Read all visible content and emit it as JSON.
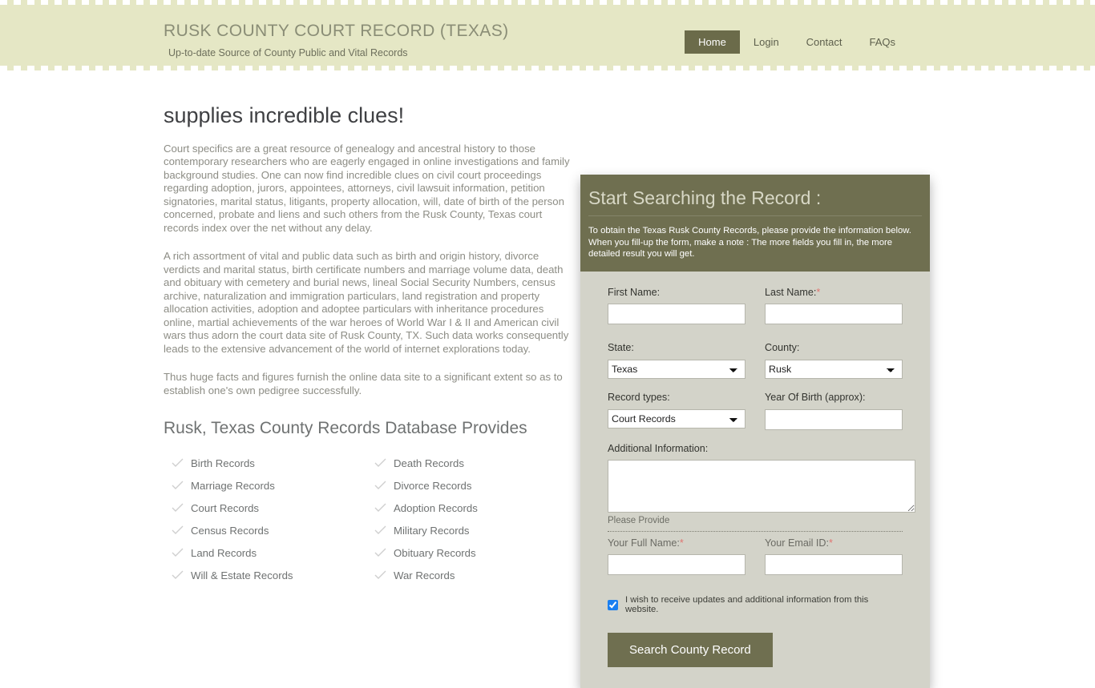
{
  "header": {
    "title": "RUSK COUNTY COURT RECORD (TEXAS)",
    "subtitle": "Up-to-date Source of  County Public and Vital Records",
    "nav": [
      {
        "label": "Home",
        "active": true
      },
      {
        "label": "Login",
        "active": false
      },
      {
        "label": "Contact",
        "active": false
      },
      {
        "label": "FAQs",
        "active": false
      }
    ],
    "colors": {
      "background": "#e5e7c5",
      "active_nav_bg": "#6b6b4a",
      "title": "#8a8d76"
    }
  },
  "content": {
    "heading": "supplies incredible clues!",
    "paragraphs": [
      "Court specifics are a great resource of genealogy and ancestral history to those contemporary researchers who are eagerly engaged in online investigations and family background studies. One can now find incredible clues on civil court proceedings regarding adoption, jurors, appointees, attorneys, civil lawsuit information, petition signatories, marital status, litigants, property allocation, will, date of birth of the person concerned, probate and liens and such others from the Rusk County, Texas court records index over the net without any delay.",
      "A rich assortment of vital and public data such as birth and origin history, divorce verdicts and marital status, birth certificate numbers and marriage volume data, death and obituary with cemetery and burial news, lineal Social Security Numbers, census archive, naturalization and immigration particulars, land registration and property allocation activities, adoption and adoptee particulars with inheritance procedures online, martial achievements of the war heroes of World War I & II and American civil wars thus adorn the court data site of Rusk County, TX. Such data works consequently leads to the extensive advancement of the world of internet explorations today.",
      "Thus huge facts and figures furnish the online data site to a significant extent so as to establish one's own pedigree successfully."
    ],
    "records_heading": "Rusk, Texas County Records Database Provides",
    "records_left": [
      "Birth Records",
      "Marriage Records",
      "Court Records",
      "Census Records",
      "Land Records",
      "Will & Estate Records"
    ],
    "records_right": [
      "Death Records",
      "Divorce Records",
      "Adoption Records",
      "Military Records",
      "Obituary Records",
      "War Records"
    ]
  },
  "form": {
    "title": "Start Searching the Record :",
    "description": "To obtain the Texas Rusk County Records, please provide the information below. When you fill-up the form, make a note : The more fields you fill in, the more detailed result you will get.",
    "first_name_label": "First Name:",
    "first_name_value": "",
    "last_name_label": "Last Name:",
    "last_name_required": "*",
    "last_name_value": "",
    "state_label": "State:",
    "state_value": "Texas",
    "county_label": "County:",
    "county_value": "Rusk",
    "record_types_label": "Record types:",
    "record_types_value": "Court Records",
    "year_of_birth_label": "Year Of Birth (approx):",
    "year_of_birth_value": "",
    "additional_info_label": "Additional Information:",
    "additional_info_value": "",
    "additional_info_hint": "Please Provide",
    "full_name_label": "Your Full Name:",
    "full_name_required": "*",
    "full_name_value": "",
    "email_label": "Your Email ID:",
    "email_required": "*",
    "email_value": "",
    "updates_checkbox_label": "I wish to receive updates and additional information from this website.",
    "updates_checked": true,
    "submit_label": "Search County Record",
    "colors": {
      "header_bg": "#6f6f50",
      "body_bg": "#d3d3c9",
      "button_bg": "#6f6f50",
      "required": "#e0736f"
    }
  }
}
